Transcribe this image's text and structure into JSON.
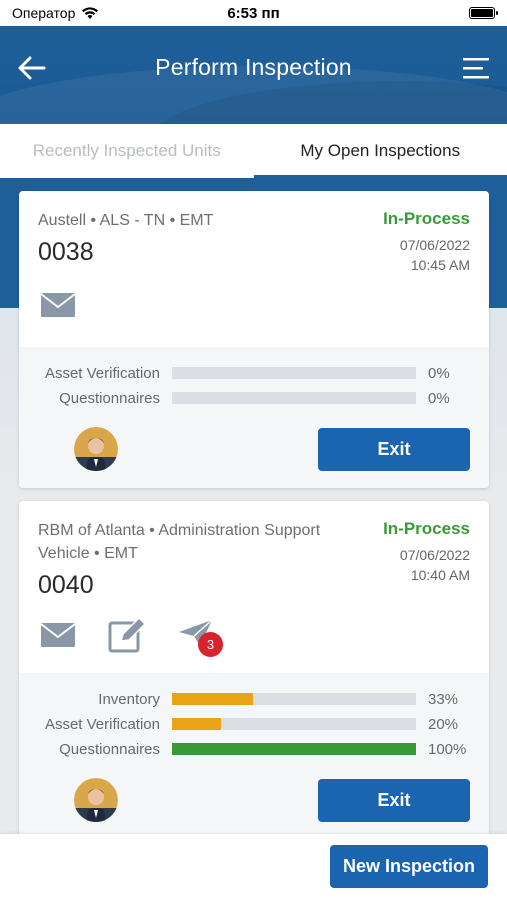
{
  "status_bar": {
    "carrier": "Оператор",
    "time": "6:53 пп"
  },
  "header": {
    "title": "Perform Inspection"
  },
  "tabs": [
    {
      "label": "Recently Inspected Units",
      "active": false
    },
    {
      "label": "My Open Inspections",
      "active": true
    }
  ],
  "cards": [
    {
      "unit_desc": "Austell • ALS - TN • EMT",
      "unit_number": "0038",
      "status": "In-Process",
      "date": "07/06/2022",
      "time": "10:45 AM",
      "icons": [
        "mail-icon"
      ],
      "progress": [
        {
          "label": "Asset Verification",
          "percent_text": "0%",
          "value": 0,
          "color": "#e8a416"
        },
        {
          "label": "Questionnaires",
          "percent_text": "0%",
          "value": 0,
          "color": "#3a9a3a"
        }
      ],
      "exit_label": "Exit"
    },
    {
      "unit_desc": "RBM of Atlanta • Administration Support Vehicle • EMT",
      "unit_number": "0040",
      "status": "In-Process",
      "date": "07/06/2022",
      "time": "10:40 AM",
      "icons": [
        "mail-icon",
        "edit-icon",
        "send-icon"
      ],
      "badge_count": "3",
      "progress": [
        {
          "label": "Inventory",
          "percent_text": "33%",
          "value": 0.33,
          "color": "#e8a416"
        },
        {
          "label": "Asset Verification",
          "percent_text": "20%",
          "value": 0.2,
          "color": "#e8a416"
        },
        {
          "label": "Questionnaires",
          "percent_text": "100%",
          "value": 1.0,
          "color": "#3a9a3a"
        }
      ],
      "exit_label": "Exit"
    }
  ],
  "footer": {
    "new_inspection_label": "New Inspection"
  },
  "colors": {
    "primary": "#1f5f99",
    "button": "#1a64b0",
    "status_green": "#3a9a3a",
    "progress_orange": "#e8a416",
    "badge_red": "#d9232d"
  }
}
